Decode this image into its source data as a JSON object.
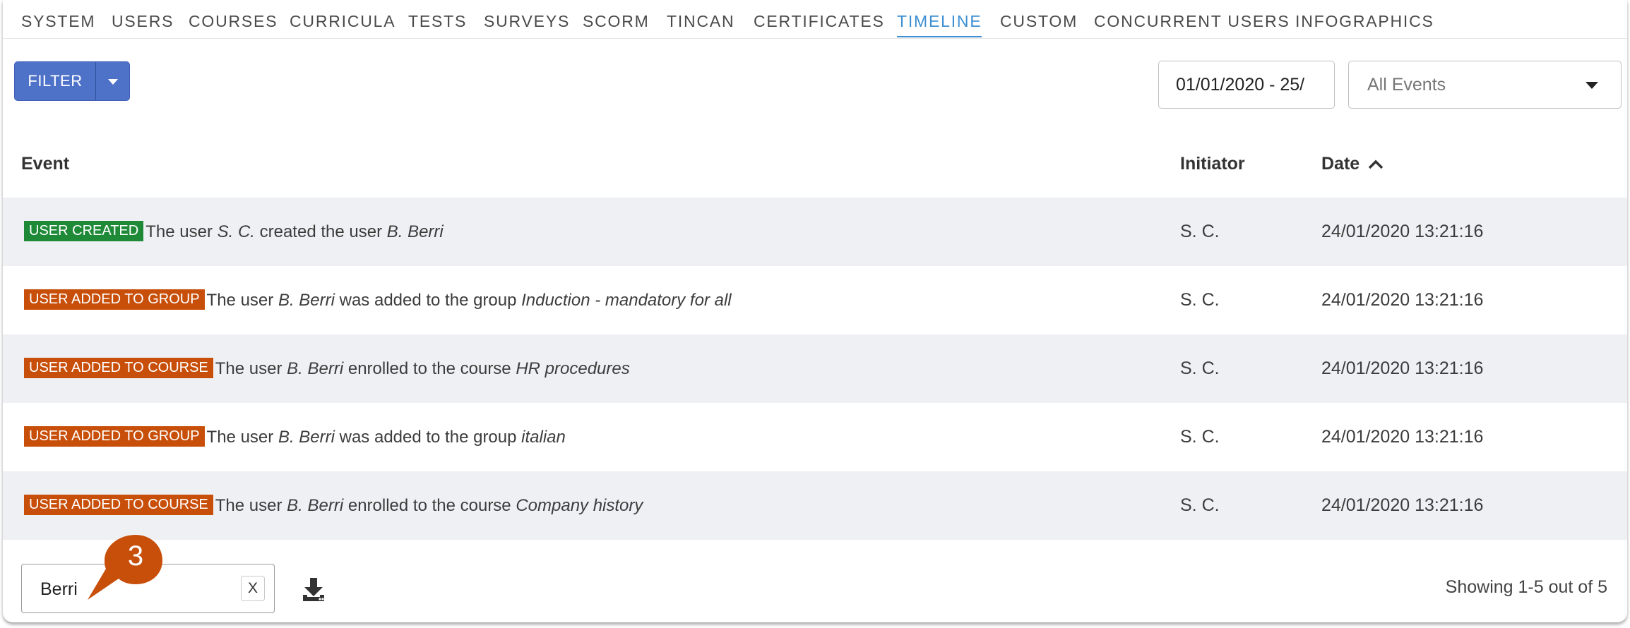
{
  "tabs": [
    {
      "label": "SYSTEM",
      "active": false
    },
    {
      "label": "USERS",
      "active": false
    },
    {
      "label": "COURSES",
      "active": false
    },
    {
      "label": "CURRICULA",
      "active": false
    },
    {
      "label": "TESTS",
      "active": false
    },
    {
      "label": "SURVEYS",
      "active": false
    },
    {
      "label": "SCORM",
      "active": false
    },
    {
      "label": "TINCAN",
      "active": false
    },
    {
      "label": "CERTIFICATES",
      "active": false
    },
    {
      "label": "TIMELINE",
      "active": true
    },
    {
      "label": "CUSTOM",
      "active": false
    },
    {
      "label": "CONCURRENT USERS",
      "active": false
    },
    {
      "label": "INFOGRAPHICS",
      "active": false
    }
  ],
  "toolbar": {
    "filter_label": "FILTER",
    "date_range_value": "01/01/2020 - 25/",
    "events_select_value": "All Events"
  },
  "table": {
    "headers": {
      "event": "Event",
      "initiator": "Initiator",
      "date": "Date"
    },
    "sort": {
      "column": "date",
      "direction": "ascending",
      "icon": "chevron-up-icon"
    },
    "rows": [
      {
        "badge": "USER CREATED",
        "badge_color": "#1e8a37",
        "parts": [
          {
            "text": "The user ",
            "italic": false
          },
          {
            "text": "S. C.",
            "italic": true
          },
          {
            "text": " created the user ",
            "italic": false
          },
          {
            "text": "B. Berri",
            "italic": true
          }
        ],
        "initiator": "S. C.",
        "date": "24/01/2020 13:21:16"
      },
      {
        "badge": "USER ADDED TO GROUP",
        "badge_color": "#c84f0a",
        "parts": [
          {
            "text": "The user ",
            "italic": false
          },
          {
            "text": "B. Berri",
            "italic": true
          },
          {
            "text": " was added to the group ",
            "italic": false
          },
          {
            "text": "Induction - mandatory for all",
            "italic": true
          }
        ],
        "initiator": "S. C.",
        "date": "24/01/2020 13:21:16"
      },
      {
        "badge": "USER ADDED TO COURSE",
        "badge_color": "#c84f0a",
        "parts": [
          {
            "text": "The user ",
            "italic": false
          },
          {
            "text": "B. Berri",
            "italic": true
          },
          {
            "text": " enrolled to the course ",
            "italic": false
          },
          {
            "text": "HR procedures",
            "italic": true
          }
        ],
        "initiator": "S. C.",
        "date": "24/01/2020 13:21:16"
      },
      {
        "badge": "USER ADDED TO GROUP",
        "badge_color": "#c84f0a",
        "parts": [
          {
            "text": "The user ",
            "italic": false
          },
          {
            "text": "B. Berri",
            "italic": true
          },
          {
            "text": " was added to the group ",
            "italic": false
          },
          {
            "text": "italian",
            "italic": true
          }
        ],
        "initiator": "S. C.",
        "date": "24/01/2020 13:21:16"
      },
      {
        "badge": "USER ADDED TO COURSE",
        "badge_color": "#c84f0a",
        "parts": [
          {
            "text": "The user ",
            "italic": false
          },
          {
            "text": "B. Berri",
            "italic": true
          },
          {
            "text": " enrolled to the course ",
            "italic": false
          },
          {
            "text": "Company history",
            "italic": true
          }
        ],
        "initiator": "S. C.",
        "date": "24/01/2020 13:21:16"
      }
    ]
  },
  "footer": {
    "search_value": "Berri",
    "clear_label": "X",
    "download_icon": "download-icon",
    "showing_text": "Showing 1-5 out of 5"
  },
  "callout": {
    "number": "3",
    "color": "#c84f0a"
  },
  "colors": {
    "accent": "#3d8fd1",
    "button": "#4f72c9",
    "row_alt": "#eef0f3"
  }
}
